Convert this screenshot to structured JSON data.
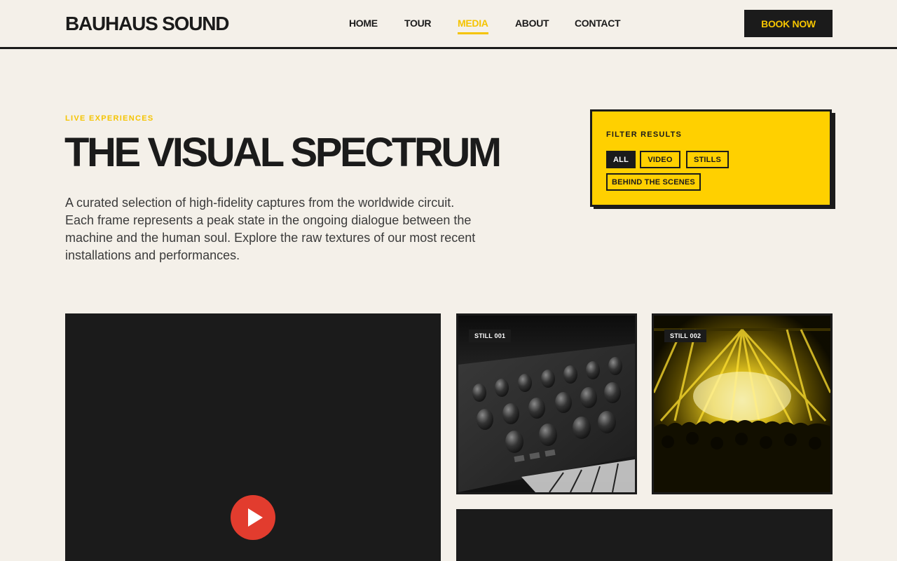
{
  "header": {
    "logo": "BAUHAUS SOUND",
    "nav": [
      {
        "label": "HOME",
        "active": false
      },
      {
        "label": "TOUR",
        "active": false
      },
      {
        "label": "MEDIA",
        "active": true
      },
      {
        "label": "ABOUT",
        "active": false
      },
      {
        "label": "CONTACT",
        "active": false
      }
    ],
    "cta_label": "BOOK NOW"
  },
  "hero": {
    "eyebrow": "LIVE EXPERIENCES",
    "title": "THE VISUAL SPECTRUM",
    "description": "A curated selection of high-fidelity captures from the worldwide circuit. Each frame represents a peak state in the ongoing dialogue between the machine and the human soul. Explore the raw textures of our most recent installations and performances."
  },
  "filter": {
    "title": "FILTER RESULTS",
    "options": [
      {
        "label": "ALL",
        "active": true
      },
      {
        "label": "VIDEO",
        "active": false
      },
      {
        "label": "STILLS",
        "active": false
      },
      {
        "label": "BEHIND THE SCENES",
        "active": false
      }
    ]
  },
  "media": {
    "stills": [
      {
        "badge": "STILL 001",
        "icon": "synthesizer-image"
      },
      {
        "badge": "STILL 002",
        "icon": "concert-lights-image"
      }
    ],
    "video_icon": "play-icon"
  },
  "colors": {
    "background": "#f4f0e9",
    "ink": "#1b1b1b",
    "accent_yellow": "#ffd000",
    "active_nav": "#f5c400",
    "play_red": "#e23c2e"
  }
}
